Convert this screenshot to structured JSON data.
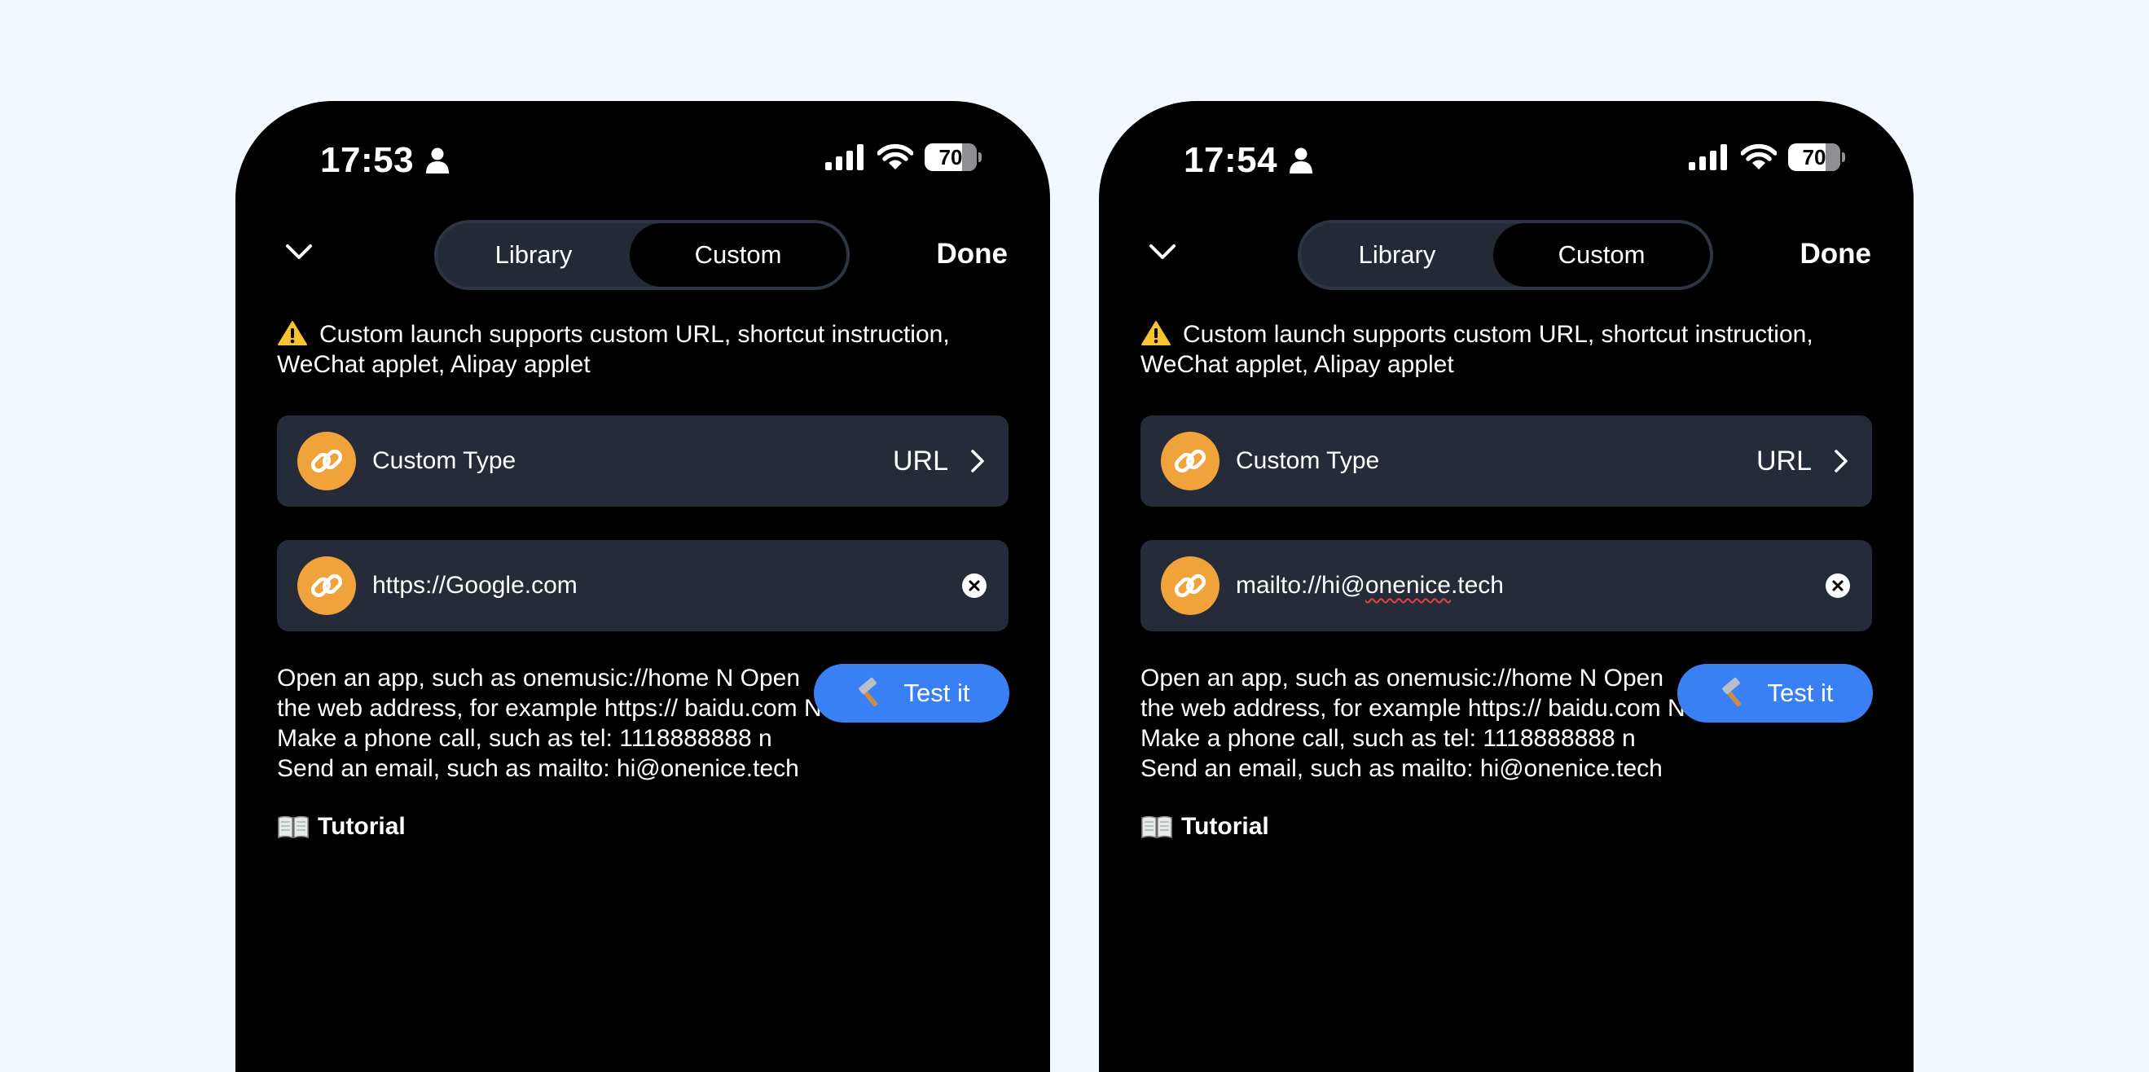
{
  "colors": {
    "page_background": "#f3f7fe",
    "phone_background": "#000000",
    "card_background": "#252b38",
    "segment_background": "#232a36",
    "accent_orange": "#f0a33a",
    "button_blue": "#3a80f5"
  },
  "screens": [
    {
      "status": {
        "time": "17:53",
        "battery": "70"
      },
      "nav": {
        "tabs": [
          "Library",
          "Custom"
        ],
        "selected_tab": "Custom",
        "done_label": "Done"
      },
      "warning_text": "Custom launch supports custom URL, shortcut instruction, WeChat applet, Alipay applet",
      "custom_type": {
        "label": "Custom Type",
        "value": "URL"
      },
      "url_input": {
        "value": "https://Google.com"
      },
      "help_text": "Open an app, such as onemusic://home N Open the web address, for example https:// baidu.com N Make a phone call, such as tel: 1118888888  n Send an email, such as mailto: hi@onenice.tech",
      "tutorial_label": "Tutorial",
      "test_button_label": "Test it"
    },
    {
      "status": {
        "time": "17:54",
        "battery": "70"
      },
      "nav": {
        "tabs": [
          "Library",
          "Custom"
        ],
        "selected_tab": "Custom",
        "done_label": "Done"
      },
      "warning_text": "Custom launch supports custom URL, shortcut instruction, WeChat applet, Alipay applet",
      "custom_type": {
        "label": "Custom Type",
        "value": "URL"
      },
      "url_input": {
        "value": "mailto://hi@onenice.tech",
        "value_prefix": "mailto://hi@",
        "value_misspelled": "onenice",
        "value_suffix": ".tech"
      },
      "help_text": "Open an app, such as onemusic://home N Open the web address, for example https:// baidu.com N Make a phone call, such as tel: 1118888888  n Send an email, such as mailto: hi@onenice.tech",
      "tutorial_label": "Tutorial",
      "test_button_label": "Test it"
    }
  ]
}
